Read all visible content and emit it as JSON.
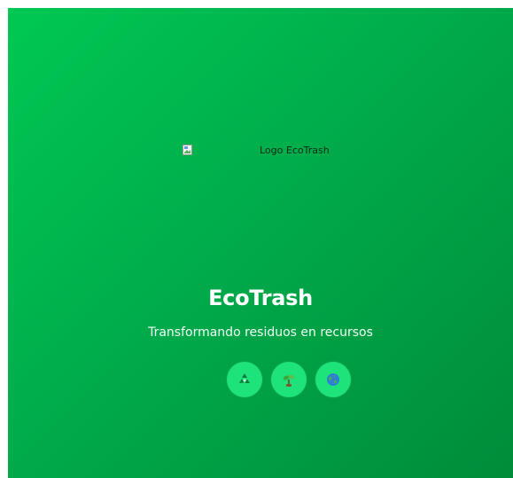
{
  "logo": {
    "alt_text": "Logo EcoTrash"
  },
  "hero": {
    "title": "EcoTrash",
    "subtitle": "Transformando residuos en recursos"
  },
  "feature_icons": [
    {
      "icon": "recycle-icon"
    },
    {
      "icon": "seedling-icon"
    },
    {
      "icon": "globe-icon"
    }
  ],
  "colors": {
    "gradient_start": "#00c853",
    "gradient_end": "#008c3a",
    "icon_circle": "#1ee27a",
    "text": "#ffffff"
  }
}
